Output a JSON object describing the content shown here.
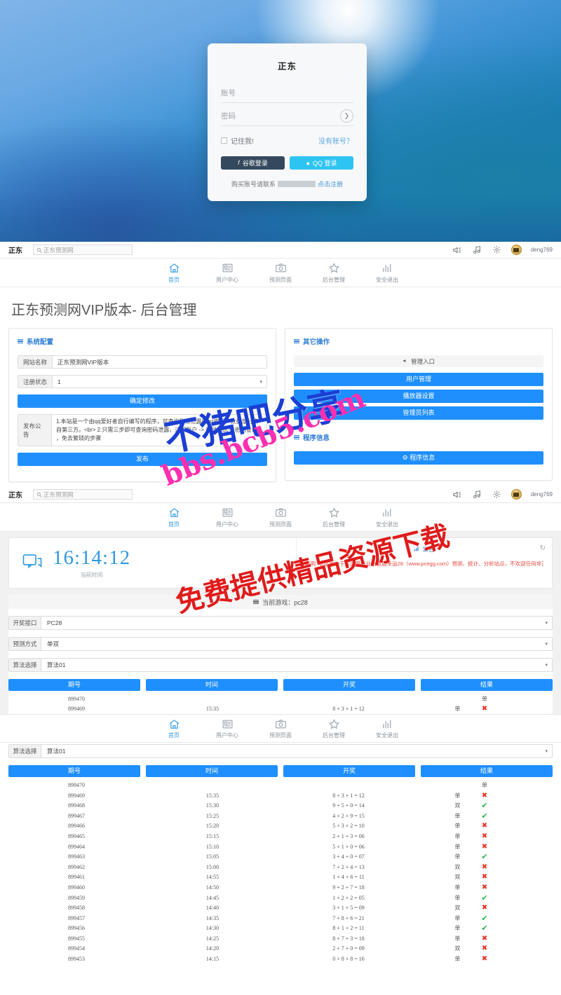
{
  "login": {
    "title": "正东",
    "account_placeholder": "账号",
    "password_placeholder": "密码",
    "go_icon": "chevron-right-icon",
    "remember_label": "记住我!",
    "forgot_label": "没有账号？",
    "google_label": "谷歌登录",
    "qq_label": "QQ 登录",
    "foot_prefix": "购买账号请联系",
    "register_label": "点击注册"
  },
  "navbar": {
    "logo": "正东",
    "search_placeholder": "正东预测网",
    "search_value": "",
    "icons": [
      "megaphone-icon",
      "music-icon",
      "gear-icon"
    ],
    "username": "deng769"
  },
  "navbar2": {
    "logo": "正东",
    "search_placeholder": "正东预测网",
    "username": "deng769"
  },
  "subnav": {
    "items": [
      {
        "label": "首页",
        "icon": "home-icon",
        "active": true
      },
      {
        "label": "用户中心",
        "icon": "id-card-icon",
        "active": false
      },
      {
        "label": "预测页面",
        "icon": "camera-icon",
        "active": false
      },
      {
        "label": "后台管理",
        "icon": "star-icon",
        "active": false
      },
      {
        "label": "安全退出",
        "icon": "bar-chart-icon",
        "active": false
      }
    ]
  },
  "admin": {
    "page_title": "正东预测网VIP版本- 后台管理",
    "left_panel": {
      "heading": "系统配置",
      "heading_icon": "menu-icon",
      "site_name_label": "网站名称",
      "site_name_value": "正东预测网VIP版本",
      "reg_status_label": "注册状态",
      "reg_status_value": "1",
      "confirm_label": "确定修改",
      "notice_label": "发布公告",
      "notice_value": "1.本站是一个由qq爱好者自行编写的程序，可查询到您泄露的qq密码，数据部分来自第三方。<br>\n2.只需三步即可查询密码泄露，注册账户 -> 登录系统-> 密码查询 ，免去繁琐的步骤",
      "publish_label": "发布"
    },
    "right_panel": {
      "heading": "其它操作",
      "heading_icon": "menu-icon",
      "entry_label": "管理入口",
      "entry_icon": "megaphone-icon",
      "buttons": [
        "用户管理",
        "播放器设置",
        "管理员列表"
      ],
      "info_heading": "程序信息",
      "info_heading_icon": "menu-icon",
      "info_button": "程序信息",
      "info_button_icon": "gear-icon"
    }
  },
  "prediction": {
    "clock_icon": "chat-icon",
    "time": "16:14:12",
    "time_label": "当前时间",
    "notice_heading": "公告",
    "notice_heading_icon": "signal-icon",
    "notice_text": "声明: 本站致力于打造最专业的蓝盾幸运28（www.pcegg.com）预测、统计、分析站点，不欢迎任何非正规28游戏，请任何非法信息勿扰",
    "refresh_icon": "refresh-icon",
    "game_bar_label": "当前游戏：pc28",
    "game_bar_icon": "menu-icon",
    "selects": [
      {
        "label": "开奖接口",
        "value": "PC28"
      },
      {
        "label": "预测方式",
        "value": "单双"
      },
      {
        "label": "算法选择",
        "value": "算法01"
      }
    ],
    "table_headers": [
      "期号",
      "时间",
      "开奖",
      "结果"
    ],
    "rows_top": [
      {
        "period": "899470",
        "time": "",
        "draw": "",
        "pred": "",
        "result": "单",
        "mark": ""
      },
      {
        "period": "899469",
        "time": "15:35",
        "draw": "8 + 3 + 1 = 12",
        "pred": "单",
        "result": "",
        "mark": "no"
      }
    ],
    "rows": [
      {
        "period": "899470",
        "time": "",
        "draw": "",
        "pred": "",
        "result": "单",
        "mark": ""
      },
      {
        "period": "899469",
        "time": "15:35",
        "draw": "8 + 3 + 1 = 12",
        "pred": "单",
        "result": "",
        "mark": "no"
      },
      {
        "period": "899468",
        "time": "15:30",
        "draw": "9 + 5 + 0 = 14",
        "pred": "双",
        "result": "",
        "mark": "ok"
      },
      {
        "period": "899467",
        "time": "15:25",
        "draw": "4 + 2 + 9 = 15",
        "pred": "单",
        "result": "",
        "mark": "ok"
      },
      {
        "period": "899466",
        "time": "15:20",
        "draw": "5 + 3 + 2 = 10",
        "pred": "单",
        "result": "",
        "mark": "no"
      },
      {
        "period": "899465",
        "time": "15:15",
        "draw": "2 + 1 + 3 = 06",
        "pred": "单",
        "result": "",
        "mark": "no"
      },
      {
        "period": "899464",
        "time": "15:10",
        "draw": "5 + 1 + 0 = 06",
        "pred": "单",
        "result": "",
        "mark": "no"
      },
      {
        "period": "899463",
        "time": "15:05",
        "draw": "3 + 4 + 0 = 07",
        "pred": "单",
        "result": "",
        "mark": "ok"
      },
      {
        "period": "899462",
        "time": "15:00",
        "draw": "7 + 2 + 4 = 13",
        "pred": "双",
        "result": "",
        "mark": "no"
      },
      {
        "period": "899461",
        "time": "14:55",
        "draw": "1 + 4 + 6 = 11",
        "pred": "双",
        "result": "",
        "mark": "no"
      },
      {
        "period": "899460",
        "time": "14:50",
        "draw": "9 + 2 + 7 = 18",
        "pred": "单",
        "result": "",
        "mark": "no"
      },
      {
        "period": "899459",
        "time": "14:45",
        "draw": "1 + 2 + 2 = 05",
        "pred": "单",
        "result": "",
        "mark": "ok"
      },
      {
        "period": "899458",
        "time": "14:40",
        "draw": "3 + 1 + 5 = 09",
        "pred": "双",
        "result": "",
        "mark": "no"
      },
      {
        "period": "899457",
        "time": "14:35",
        "draw": "7 + 8 + 6 = 21",
        "pred": "单",
        "result": "",
        "mark": "ok"
      },
      {
        "period": "899456",
        "time": "14:30",
        "draw": "8 + 1 + 2 = 11",
        "pred": "单",
        "result": "",
        "mark": "ok"
      },
      {
        "period": "899455",
        "time": "14:25",
        "draw": "8 + 7 + 3 = 18",
        "pred": "单",
        "result": "",
        "mark": "no"
      },
      {
        "period": "899454",
        "time": "14:20",
        "draw": "2 + 7 + 0 = 09",
        "pred": "双",
        "result": "",
        "mark": "no"
      },
      {
        "period": "899453",
        "time": "14:15",
        "draw": "0 + 8 + 8 = 16",
        "pred": "单",
        "result": "",
        "mark": "no"
      }
    ]
  },
  "watermarks": {
    "w1": "不猪吧分享",
    "w2": "bbs.bcb5.com",
    "w3": "免费提供精品资源下载"
  }
}
